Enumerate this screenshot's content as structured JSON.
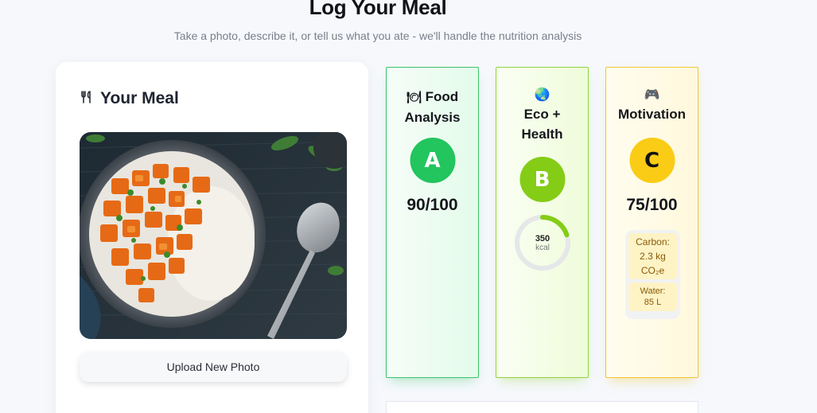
{
  "header": {
    "title": "Log Your Meal",
    "subtitle": "Take a photo, describe it, or tell us what you ate - we'll handle the nutrition analysis"
  },
  "meal_panel": {
    "icon": "fork-knife-icon",
    "title": "Your Meal",
    "upload_label": "Upload New Photo"
  },
  "cards": {
    "food": {
      "emoji": "🍽",
      "title_line1": "Food",
      "title_line2": "Analysis",
      "grade": "A",
      "score": "90/100",
      "color": "#22c55e"
    },
    "eco": {
      "emoji": "🌏",
      "title_line1": "Eco +",
      "title_line2": "Health",
      "grade": "B",
      "kcal": "350",
      "kcal_unit": "kcal",
      "kcal_progress": 0.2,
      "color": "#84cc16"
    },
    "motivation": {
      "emoji": "🎮",
      "title": "Motivation",
      "grade": "C",
      "score": "75/100",
      "carbon_label": "Carbon:",
      "carbon_value": "2.3 kg",
      "carbon_unit": "CO₂e",
      "water_label": "Water:",
      "water_value": "85 L",
      "color": "#facc15"
    }
  }
}
